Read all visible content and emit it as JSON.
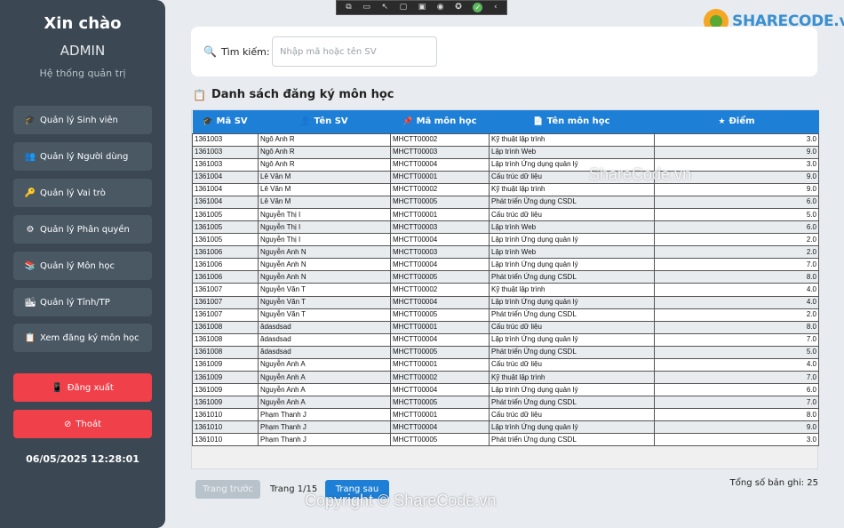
{
  "sidebar": {
    "greeting": "Xin chào",
    "user": "ADMIN",
    "subtitle": "Hệ thống quản trị",
    "items": [
      {
        "label": "Quản lý Sinh viên",
        "icon": "graduation-cap-icon",
        "glyph": "🎓"
      },
      {
        "label": "Quản lý Người dùng",
        "icon": "users-icon",
        "glyph": "👥"
      },
      {
        "label": "Quản lý Vai trò",
        "icon": "key-icon",
        "glyph": "🔑"
      },
      {
        "label": "Quản lý Phân quyền",
        "icon": "gear-icon",
        "glyph": "⚙"
      },
      {
        "label": "Quản lý Môn học",
        "icon": "books-icon",
        "glyph": "📚"
      },
      {
        "label": "Quản lý Tỉnh/TP",
        "icon": "city-icon",
        "glyph": "🏙"
      },
      {
        "label": "Xem đăng ký môn học",
        "icon": "list-icon",
        "glyph": "📋"
      }
    ],
    "logout_label": "Đăng xuất",
    "logout_glyph": "📱",
    "exit_label": "Thoát",
    "exit_glyph": "⊘",
    "datetime": "06/05/2025 12:28:01"
  },
  "logo": {
    "text": "SHARECODE.vn"
  },
  "search": {
    "label": "Tìm kiếm:",
    "placeholder": "Nhập mã hoặc tên SV",
    "value": ""
  },
  "section": {
    "title": "Danh sách đăng ký môn học"
  },
  "table": {
    "columns": [
      {
        "label": "Mã SV",
        "glyph": "🎓"
      },
      {
        "label": "Tên SV",
        "glyph": "👤"
      },
      {
        "label": "Mã môn học",
        "glyph": "📌"
      },
      {
        "label": "Tên môn học",
        "glyph": "📄"
      },
      {
        "label": "Điểm",
        "glyph": "★"
      }
    ],
    "rows": [
      [
        "1361003",
        "Ngô Anh R",
        "MHCTT00002",
        "Kỹ thuật lập trình",
        "3.0"
      ],
      [
        "1361003",
        "Ngô Anh R",
        "MHCTT00003",
        "Lập trình Web",
        "9.0"
      ],
      [
        "1361003",
        "Ngô Anh R",
        "MHCTT00004",
        "Lập trình Ứng dụng quản lý",
        "3.0"
      ],
      [
        "1361004",
        "Lê Văn M",
        "MHCTT00001",
        "Cấu trúc dữ liệu",
        "9.0"
      ],
      [
        "1361004",
        "Lê Văn M",
        "MHCTT00002",
        "Kỹ thuật lập trình",
        "9.0"
      ],
      [
        "1361004",
        "Lê Văn M",
        "MHCTT00005",
        "Phát triển Ứng dụng CSDL",
        "6.0"
      ],
      [
        "1361005",
        "Nguyễn Thị I",
        "MHCTT00001",
        "Cấu trúc dữ liệu",
        "5.0"
      ],
      [
        "1361005",
        "Nguyễn Thị I",
        "MHCTT00003",
        "Lập trình Web",
        "6.0"
      ],
      [
        "1361005",
        "Nguyễn Thị I",
        "MHCTT00004",
        "Lập trình Ứng dụng quản lý",
        "2.0"
      ],
      [
        "1361006",
        "Nguyễn Anh N",
        "MHCTT00003",
        "Lập trình Web",
        "2.0"
      ],
      [
        "1361006",
        "Nguyễn Anh N",
        "MHCTT00004",
        "Lập trình Ứng dụng quản lý",
        "7.0"
      ],
      [
        "1361006",
        "Nguyễn Anh N",
        "MHCTT00005",
        "Phát triển Ứng dụng CSDL",
        "8.0"
      ],
      [
        "1361007",
        "Nguyễn Văn T",
        "MHCTT00002",
        "Kỹ thuật lập trình",
        "4.0"
      ],
      [
        "1361007",
        "Nguyễn Văn T",
        "MHCTT00004",
        "Lập trình Ứng dụng quản lý",
        "4.0"
      ],
      [
        "1361007",
        "Nguyễn Văn T",
        "MHCTT00005",
        "Phát triển Ứng dụng CSDL",
        "2.0"
      ],
      [
        "1361008",
        "ădasdsad",
        "MHCTT00001",
        "Cấu trúc dữ liệu",
        "8.0"
      ],
      [
        "1361008",
        "ădasdsad",
        "MHCTT00004",
        "Lập trình Ứng dụng quản lý",
        "7.0"
      ],
      [
        "1361008",
        "ădasdsad",
        "MHCTT00005",
        "Phát triển Ứng dụng CSDL",
        "5.0"
      ],
      [
        "1361009",
        "Nguyễn Anh A",
        "MHCTT00001",
        "Cấu trúc dữ liệu",
        "4.0"
      ],
      [
        "1361009",
        "Nguyễn Anh A",
        "MHCTT00002",
        "Kỹ thuật lập trình",
        "7.0"
      ],
      [
        "1361009",
        "Nguyễn Anh A",
        "MHCTT00004",
        "Lập trình Ứng dụng quản lý",
        "6.0"
      ],
      [
        "1361009",
        "Nguyễn Anh A",
        "MHCTT00005",
        "Phát triển Ứng dụng CSDL",
        "7.0"
      ],
      [
        "1361010",
        "Phạm Thanh J",
        "MHCTT00001",
        "Cấu trúc dữ liệu",
        "8.0"
      ],
      [
        "1361010",
        "Phạm Thanh J",
        "MHCTT00004",
        "Lập trình Ứng dụng quản lý",
        "9.0"
      ],
      [
        "1361010",
        "Phạm Thanh J",
        "MHCTT00005",
        "Phát triển Ứng dụng CSDL",
        "3.0"
      ]
    ]
  },
  "pagination": {
    "prev_label": "Trang trước",
    "page_info": "Trang 1/15",
    "next_label": "Trang sau",
    "total": "Tổng số bản ghi: 25"
  },
  "watermarks": {
    "center": "ShareCode.vn",
    "bottom": "Copyright © ShareCode.vn"
  },
  "colors": {
    "sidebar_bg": "#3b4752",
    "nav_item_bg": "#4a5864",
    "danger": "#f0404a",
    "primary": "#1e7fd6"
  }
}
